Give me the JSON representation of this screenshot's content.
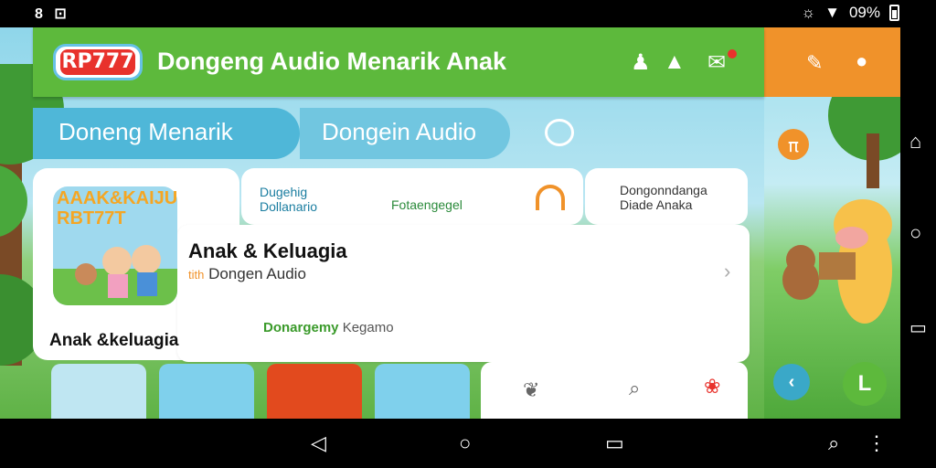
{
  "status_bar": {
    "left_icons": "8 ⊡",
    "battery": "09%"
  },
  "app": {
    "logo_text": "RP777",
    "title": "Dongeng Audio Menarik Anak",
    "tabs": [
      {
        "label": "Doneng Menarik"
      },
      {
        "label": "Dongein Audio"
      }
    ],
    "card_art_text": "AAAK&KAIJU RBT77T",
    "chips": [
      {
        "line1": "Dugehig",
        "line2": "Dollanario"
      },
      {
        "label": "Fotaengegel"
      }
    ],
    "chip_right": {
      "line1": "Dongonndanga",
      "line2": "Diade Anaka"
    },
    "feature": {
      "title": "Anak & Keluagia",
      "subtitle": "Dongen Audio",
      "subtitle_prefix": "tith"
    },
    "section_title": "Anak &keluagia",
    "subtag": {
      "bold": "Donargemy",
      "rest": "Kegamo"
    }
  },
  "colors": {
    "header_green": "#5db93c",
    "tab_blue": "#4fb7d8",
    "accent_orange": "#f0922a",
    "logo_red": "#e8322c"
  }
}
